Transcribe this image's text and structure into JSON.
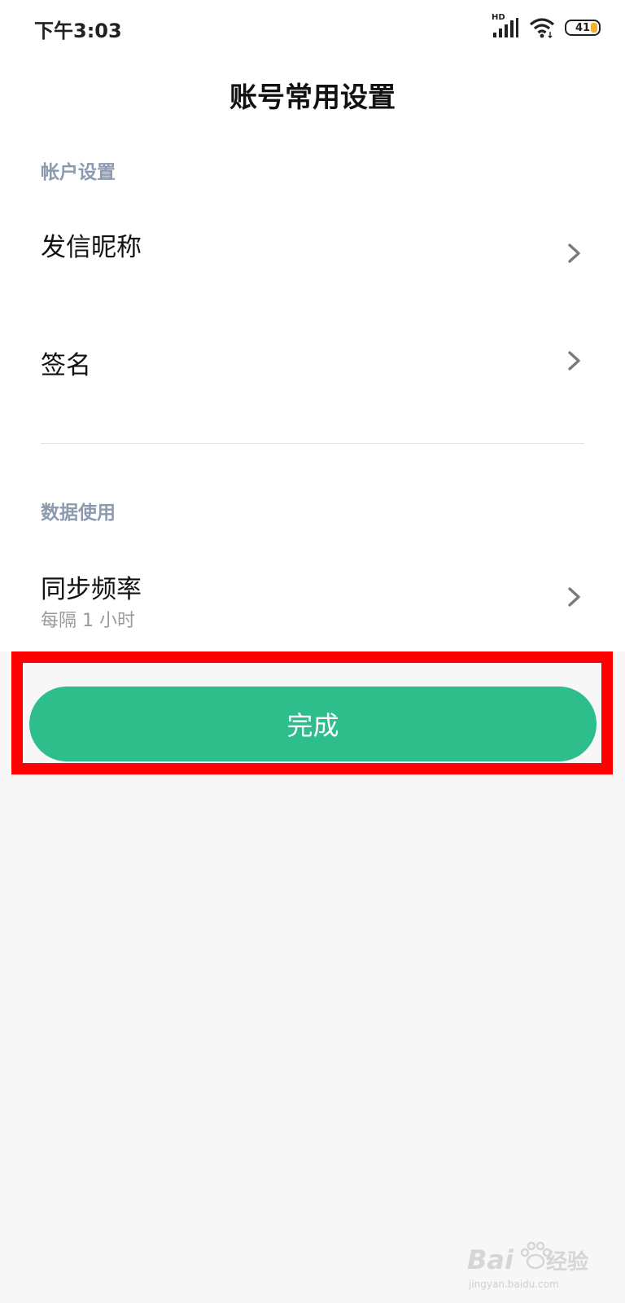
{
  "status_bar": {
    "time": "下午3:03",
    "network_label": "HD",
    "battery_level": "41",
    "icons": [
      "signal-icon",
      "wifi-icon",
      "battery-icon"
    ]
  },
  "header": {
    "title": "账号常用设置"
  },
  "sections": [
    {
      "header": "帐户设置",
      "items": [
        {
          "label": "发信昵称"
        },
        {
          "label": "签名"
        }
      ]
    },
    {
      "header": "数据使用",
      "items": [
        {
          "label": "同步频率",
          "sublabel": "每隔 1 小时"
        }
      ]
    }
  ],
  "done_button": {
    "label": "完成",
    "color": "#2dbe8b"
  },
  "highlight": {
    "color": "#ff0000"
  },
  "watermark": {
    "logo_text": "Bai",
    "logo_text_2": "经验",
    "url": "jingyan.baidu.com"
  },
  "colors": {
    "section_header": "#8c9ab0",
    "background": "#f7f7f7",
    "battery_fill": "#f2b131"
  }
}
